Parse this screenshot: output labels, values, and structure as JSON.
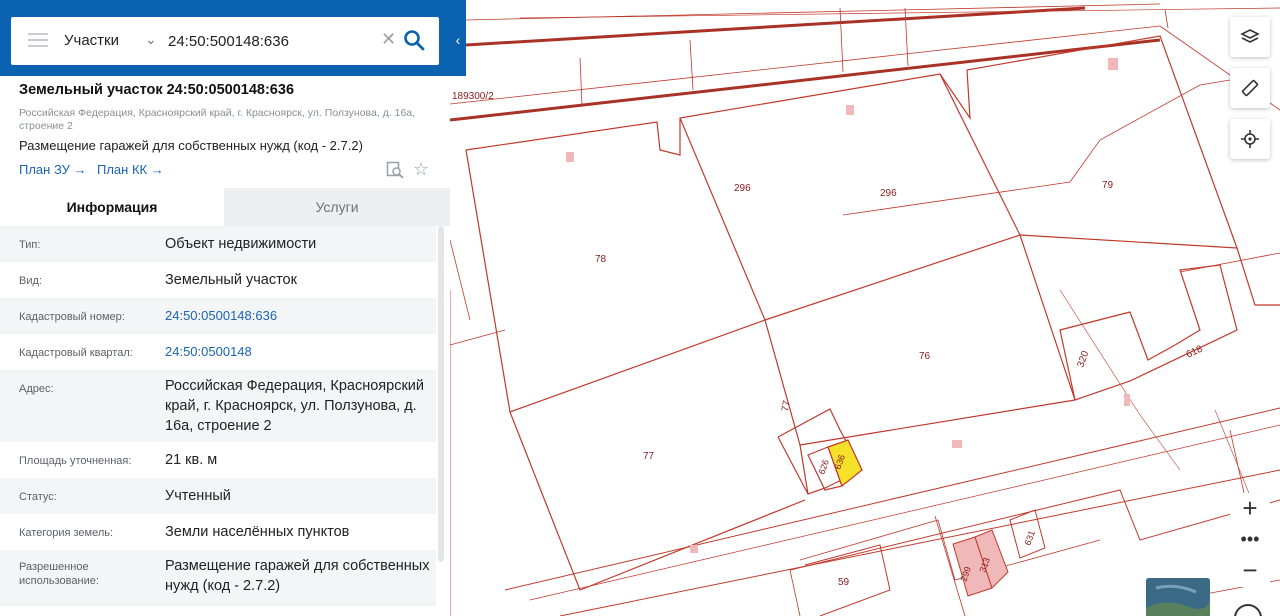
{
  "search": {
    "type_label": "Участки",
    "query": "24:50:500148:636"
  },
  "object": {
    "title": "Земельный участок 24:50:0500148:636",
    "address": "Российская Федерация, Красноярский край, г. Красноярск, ул. Ползунова, д. 16а, строение 2",
    "usage": "Размещение гаражей для собственных нужд (код - 2.7.2)",
    "plan_zu": "План ЗУ →",
    "plan_kk": "План КК →"
  },
  "tabs": {
    "info": "Информация",
    "services": "Услуги"
  },
  "info_rows": [
    {
      "label": "Тип:",
      "value": "Объект недвижимости"
    },
    {
      "label": "Вид:",
      "value": "Земельный участок"
    },
    {
      "label": "Кадастровый номер:",
      "value": "24:50:0500148:636"
    },
    {
      "label": "Кадастровый квартал:",
      "value": "24:50:0500148"
    },
    {
      "label": "Адрес:",
      "value": "Российская Федерация, Красноярский край, г. Красноярск, ул. Ползунова, д. 16а, строение 2"
    },
    {
      "label": "Площадь уточненная:",
      "value": "21 кв. м"
    },
    {
      "label": "Статус:",
      "value": "Учтенный"
    },
    {
      "label": "Категория земель:",
      "value": "Земли населённых пунктов"
    },
    {
      "label": "Разрешенное использование:",
      "value": "Размещение гаражей для собственных нужд (код - 2.7.2)"
    }
  ],
  "map": {
    "labels": {
      "parcel_top": "189300/2",
      "p296a": "296",
      "p296b": "296",
      "p79": "79",
      "p78": "78",
      "p76": "76",
      "p77a": "77",
      "p77b": "77",
      "p320": "320",
      "p618": "618",
      "p636": "636",
      "p626": "626",
      "p631": "631",
      "p313": "313",
      "p299": "299",
      "p59": "59"
    },
    "colors": {
      "parcel_line": "#c0392b",
      "parcel_line_thick": "#a93226",
      "selected_fill": "#f5e12a",
      "highlight_fill": "#f0b8b8",
      "header_blue": "#0b62b0",
      "link_blue": "#1a64b5"
    }
  },
  "icons": [
    "menu-icon",
    "chevron-down-icon",
    "clear-icon",
    "search-icon",
    "collapse-icon",
    "preview-icon",
    "star-icon",
    "layers-icon",
    "ruler-icon",
    "locate-icon",
    "zoom-in-icon",
    "more-icon",
    "zoom-out-icon"
  ]
}
